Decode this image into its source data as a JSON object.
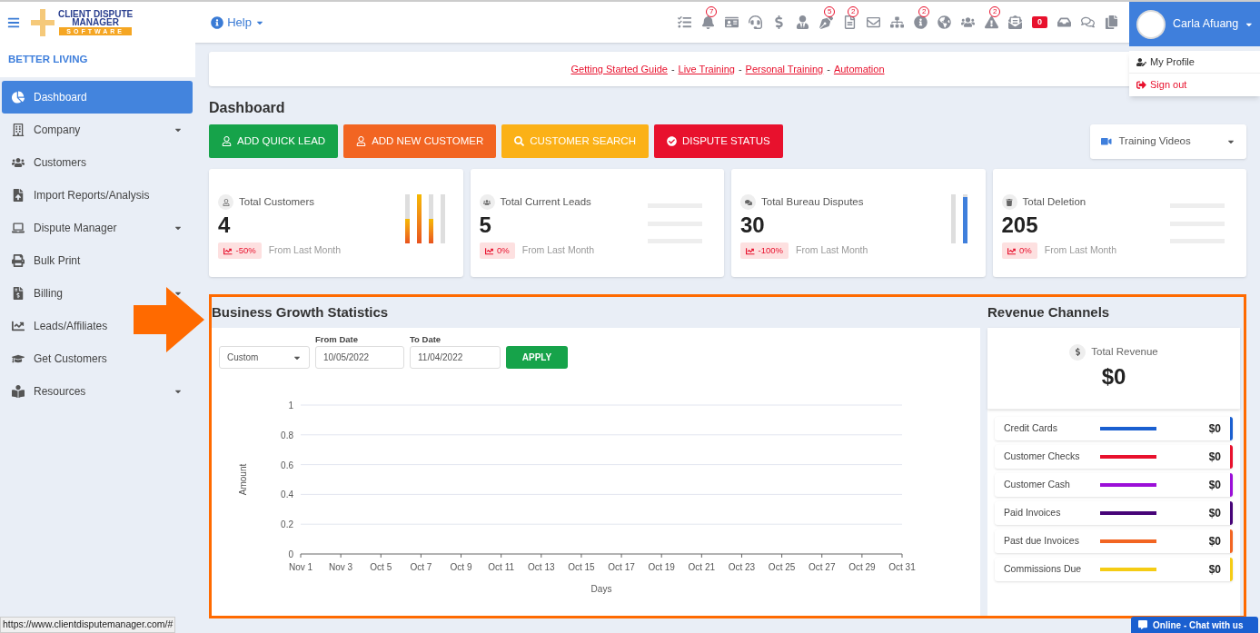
{
  "logo": {
    "line_1": "CLIENT DISPUTE",
    "line_2": "MANAGER",
    "line_3": "SOFTWARE"
  },
  "help": {
    "label": "Help"
  },
  "toolbar": {
    "badges": [
      "7",
      "5",
      "2",
      "2",
      "2"
    ],
    "cash_count": "0"
  },
  "user": {
    "name": "Carla Afuang",
    "menu": [
      "My Profile",
      "Sign out"
    ]
  },
  "sidebar": {
    "company": "BETTER LIVING",
    "items": [
      {
        "label": "Dashboard",
        "selected": true,
        "has_submenu": false
      },
      {
        "label": "Company",
        "selected": false,
        "has_submenu": true
      },
      {
        "label": "Customers",
        "selected": false,
        "has_submenu": false
      },
      {
        "label": "Import Reports/Analysis",
        "selected": false,
        "has_submenu": false
      },
      {
        "label": "Dispute Manager",
        "selected": false,
        "has_submenu": true
      },
      {
        "label": "Bulk Print",
        "selected": false,
        "has_submenu": false
      },
      {
        "label": "Billing",
        "selected": false,
        "has_submenu": true
      },
      {
        "label": "Leads/Affiliates",
        "selected": false,
        "has_submenu": false
      },
      {
        "label": "Get Customers",
        "selected": false,
        "has_submenu": false
      },
      {
        "label": "Resources",
        "selected": false,
        "has_submenu": true
      }
    ]
  },
  "links": {
    "separator": "-",
    "items": [
      "Getting Started Guide",
      "Live Training",
      "Personal Training",
      "Automation"
    ]
  },
  "page_title": "Dashboard",
  "actions": [
    {
      "label": "ADD QUICK LEAD",
      "color": "#16a34a"
    },
    {
      "label": "ADD NEW CUSTOMER",
      "color": "#f26522"
    },
    {
      "label": "CUSTOMER SEARCH",
      "color": "#fbb117"
    },
    {
      "label": "DISPUTE STATUS",
      "color": "#e8112d"
    }
  ],
  "training": {
    "label": "Training Videos"
  },
  "stats": [
    {
      "title": "Total Customers",
      "value": "4",
      "change": "-50%",
      "note": "From Last Month",
      "kind": "bars",
      "bars": [
        {
          "level": 0.5
        },
        {
          "level": 1
        },
        {
          "level": 0.5
        },
        {
          "level": 0
        }
      ]
    },
    {
      "title": "Total Current Leads",
      "value": "5",
      "change": "0%",
      "note": "From Last Month",
      "kind": "lines"
    },
    {
      "title": "Total Bureau Disputes",
      "value": "30",
      "change": "-100%",
      "note": "From Last Month",
      "kind": "bars",
      "bars": [
        {
          "level": 0
        },
        {
          "level": 0.95
        }
      ]
    },
    {
      "title": "Total Deletion",
      "value": "205",
      "change": "0%",
      "note": "From Last Month",
      "kind": "lines"
    }
  ],
  "growth": {
    "title": "Business Growth Statistics",
    "range": "Custom",
    "from_label": "From Date",
    "from": "10/05/2022",
    "to_label": "To Date",
    "to": "11/04/2022",
    "apply": "APPLY",
    "chart_data": {
      "type": "line",
      "xlabel": "Days",
      "ylabel": "Amount",
      "categories": [
        "Nov 1",
        "Nov 3",
        "Oct 5",
        "Oct 7",
        "Oct 9",
        "Oct 11",
        "Oct 13",
        "Oct 15",
        "Oct 17",
        "Oct 19",
        "Oct 21",
        "Oct 23",
        "Oct 25",
        "Oct 27",
        "Oct 29",
        "Oct 31"
      ],
      "ylim": [
        0,
        1
      ],
      "grid": true,
      "yticks": [
        0,
        0.2,
        0.4,
        0.6,
        0.8,
        1
      ]
    }
  },
  "revenue": {
    "title": "Revenue Channels",
    "total_label": "Total Revenue",
    "total": "$0",
    "channels": [
      {
        "name": "Credit Cards",
        "amount": "$0",
        "color": "#1a5fd0"
      },
      {
        "name": "Customer Checks",
        "amount": "$0",
        "color": "#e8112d"
      },
      {
        "name": "Customer Cash",
        "amount": "$0",
        "color": "#9b0fd8"
      },
      {
        "name": "Paid Invoices",
        "amount": "$0",
        "color": "#470478"
      },
      {
        "name": "Past due Invoices",
        "amount": "$0",
        "color": "#f26522"
      },
      {
        "name": "Commissions Due",
        "amount": "$0",
        "color": "#f5cc14"
      }
    ]
  },
  "status_bar": {
    "url": "https://www.clientdisputemanager.com/#"
  },
  "chat": {
    "label": "Online - Chat with us"
  }
}
